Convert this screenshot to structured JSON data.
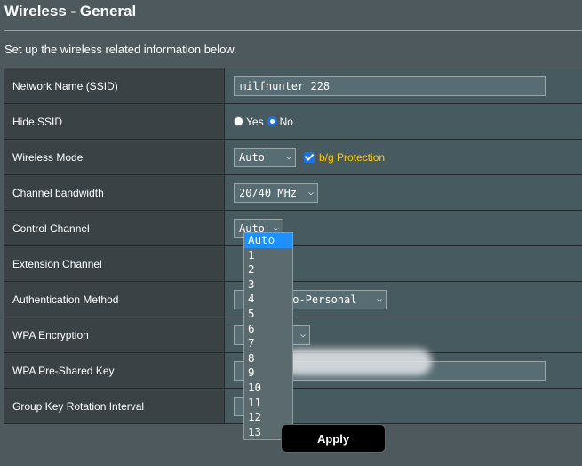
{
  "page": {
    "title": "Wireless - General",
    "description": "Set up the wireless related information below."
  },
  "fields": {
    "ssid": {
      "label": "Network Name (SSID)",
      "value": "milfhunter_228"
    },
    "hide_ssid": {
      "label": "Hide SSID",
      "yes": "Yes",
      "no": "No",
      "selected": "No"
    },
    "wireless_mode": {
      "label": "Wireless Mode",
      "value": "Auto",
      "protection_label": "b/g Protection",
      "protection_checked": true
    },
    "channel_bandwidth": {
      "label": "Channel bandwidth",
      "value": "20/40 MHz"
    },
    "control_channel": {
      "label": "Control Channel",
      "value": "Auto"
    },
    "extension_channel": {
      "label": "Extension Channel"
    },
    "auth_method": {
      "label": "Authentication Method",
      "value_visible": "to-Personal"
    },
    "wpa_encryption": {
      "label": "WPA Encryption"
    },
    "wpa_key": {
      "label": "WPA Pre-Shared Key"
    },
    "group_key": {
      "label": "Group Key Rotation Interval"
    }
  },
  "dropdown": {
    "options": [
      "Auto",
      "1",
      "2",
      "3",
      "4",
      "5",
      "6",
      "7",
      "8",
      "9",
      "10",
      "11",
      "12",
      "13"
    ],
    "selected": "Auto"
  },
  "apply_label": "Apply",
  "colors": {
    "background": "#4d595d",
    "label_cell": "#3a4246",
    "value_cell": "#475a5f",
    "accent": "#1e90ff",
    "protection": "#ffcc00"
  }
}
